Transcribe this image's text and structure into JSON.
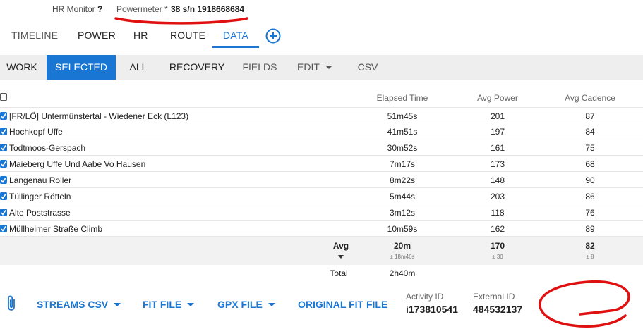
{
  "meta": {
    "hr_label": "HR Monitor",
    "hr_value": "?",
    "powermeter_label": "Powermeter *",
    "powermeter_value": "38 s/n 1918668684"
  },
  "tabs": [
    {
      "label": "TIMELINE"
    },
    {
      "label": "POWER"
    },
    {
      "label": "HR"
    },
    {
      "label": "ROUTE"
    },
    {
      "label": "DATA"
    }
  ],
  "toolbar": {
    "work": "WORK",
    "selected": "SELECTED",
    "all": "ALL",
    "recovery": "RECOVERY",
    "fields": "FIELDS",
    "edit": "EDIT",
    "csv": "CSV"
  },
  "table": {
    "headers": {
      "elapsed": "Elapsed Time",
      "power": "Avg Power",
      "cadence": "Avg Cadence"
    },
    "rows": [
      {
        "name": "[FR/LÖ] Untermünstertal - Wiedener Eck (L123)",
        "elapsed": "51m45s",
        "power": "201",
        "cadence": "87",
        "checked": true
      },
      {
        "name": "Hochkopf Uffe",
        "elapsed": "41m51s",
        "power": "197",
        "cadence": "84",
        "checked": true
      },
      {
        "name": "Todtmoos-Gerspach",
        "elapsed": "30m52s",
        "power": "161",
        "cadence": "75",
        "checked": true
      },
      {
        "name": "Maieberg Uffe Und Aabe Vo Hausen",
        "elapsed": "7m17s",
        "power": "173",
        "cadence": "68",
        "checked": true
      },
      {
        "name": "Langenau Roller",
        "elapsed": "8m22s",
        "power": "148",
        "cadence": "90",
        "checked": true
      },
      {
        "name": "Tüllinger Rötteln",
        "elapsed": "5m44s",
        "power": "203",
        "cadence": "86",
        "checked": true
      },
      {
        "name": "Alte Poststrasse",
        "elapsed": "3m12s",
        "power": "118",
        "cadence": "76",
        "checked": true
      },
      {
        "name": "Müllheimer Straße Climb",
        "elapsed": "10m59s",
        "power": "162",
        "cadence": "89",
        "checked": true
      }
    ],
    "avg": {
      "label": "Avg",
      "elapsed": "20m",
      "elapsed_sd": "± 18m46s",
      "power": "170",
      "power_sd": "± 30",
      "cadence": "82",
      "cadence_sd": "± 8"
    },
    "total": {
      "label": "Total",
      "elapsed": "2h40m"
    }
  },
  "footer": {
    "streams_csv": "STREAMS CSV",
    "fit_file": "FIT FILE",
    "gpx_file": "GPX FILE",
    "original_fit_file": "ORIGINAL FIT FILE",
    "activity_id_label": "Activity ID",
    "activity_id": "i173810541",
    "external_id_label": "External ID",
    "external_id": "484532137"
  },
  "colors": {
    "accent": "#1976d2",
    "annotation": "#e01010"
  }
}
